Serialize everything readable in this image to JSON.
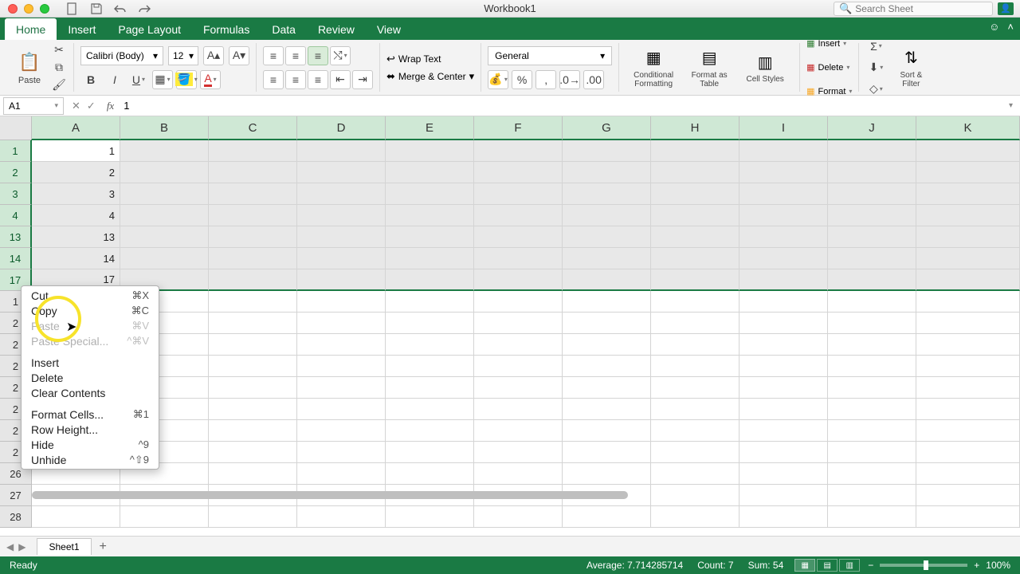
{
  "window": {
    "title": "Workbook1",
    "search_placeholder": "Search Sheet"
  },
  "tabs": [
    "Home",
    "Insert",
    "Page Layout",
    "Formulas",
    "Data",
    "Review",
    "View"
  ],
  "ribbon": {
    "paste": "Paste",
    "font_name": "Calibri (Body)",
    "font_size": "12",
    "number_format": "General",
    "wrap": "Wrap Text",
    "merge": "Merge & Center",
    "cond_fmt": "Conditional Formatting",
    "fmt_table": "Format as Table",
    "cell_styles": "Cell Styles",
    "insert": "Insert",
    "delete": "Delete",
    "format": "Format",
    "sort_filter": "Sort & Filter"
  },
  "formula_bar": {
    "name_box": "A1",
    "value": "1"
  },
  "columns": [
    "A",
    "B",
    "C",
    "D",
    "E",
    "F",
    "G",
    "H",
    "I",
    "J",
    "K"
  ],
  "rows": [
    {
      "n": "1",
      "a": "1",
      "sel": true,
      "active": true
    },
    {
      "n": "2",
      "a": "2",
      "sel": true
    },
    {
      "n": "3",
      "a": "3",
      "sel": true
    },
    {
      "n": "4",
      "a": "4",
      "sel": true
    },
    {
      "n": "13",
      "a": "13",
      "sel": true
    },
    {
      "n": "14",
      "a": "14",
      "sel": true
    },
    {
      "n": "17",
      "a": "17",
      "sel": true,
      "last": true
    },
    {
      "n": "1"
    },
    {
      "n": "2"
    },
    {
      "n": "2"
    },
    {
      "n": "2"
    },
    {
      "n": "2"
    },
    {
      "n": "2"
    },
    {
      "n": "2"
    },
    {
      "n": "2"
    },
    {
      "n": "26"
    },
    {
      "n": "27"
    },
    {
      "n": "28"
    }
  ],
  "context_menu": [
    {
      "label": "Cut",
      "shortcut": "⌘X"
    },
    {
      "label": "Copy",
      "shortcut": "⌘C"
    },
    {
      "label": "Paste",
      "shortcut": "⌘V",
      "disabled": true
    },
    {
      "label": "Paste Special...",
      "shortcut": "^⌘V",
      "disabled": true
    },
    {
      "sep": true
    },
    {
      "label": "Insert"
    },
    {
      "label": "Delete"
    },
    {
      "label": "Clear Contents"
    },
    {
      "sep": true
    },
    {
      "label": "Format Cells...",
      "shortcut": "⌘1"
    },
    {
      "label": "Row Height..."
    },
    {
      "label": "Hide",
      "shortcut": "^9"
    },
    {
      "label": "Unhide",
      "shortcut": "^⇧9"
    }
  ],
  "sheet": {
    "name": "Sheet1"
  },
  "status": {
    "ready": "Ready",
    "average": "Average: 7.714285714",
    "count": "Count: 7",
    "sum": "Sum: 54",
    "zoom": "100%"
  }
}
